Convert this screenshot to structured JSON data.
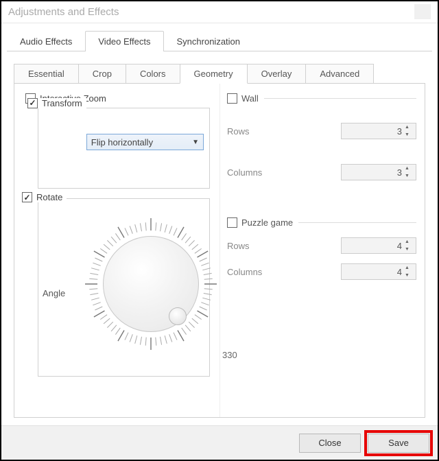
{
  "title": "Adjustments and Effects",
  "main_tabs": {
    "audio": "Audio Effects",
    "video": "Video Effects",
    "sync": "Synchronization"
  },
  "sub_tabs": {
    "essential": "Essential",
    "crop": "Crop",
    "colors": "Colors",
    "geometry": "Geometry",
    "overlay": "Overlay",
    "advanced": "Advanced"
  },
  "left": {
    "interactive_zoom": "Interactive Zoom",
    "transform": "Transform",
    "transform_value": "Flip horizontally",
    "rotate": "Rotate",
    "angle_label": "Angle",
    "tick_label": "330"
  },
  "right": {
    "wall": {
      "label": "Wall",
      "rows_label": "Rows",
      "rows": "3",
      "cols_label": "Columns",
      "cols": "3"
    },
    "puzzle": {
      "label": "Puzzle game",
      "rows_label": "Rows",
      "rows": "4",
      "cols_label": "Columns",
      "cols": "4"
    }
  },
  "footer": {
    "close": "Close",
    "save": "Save"
  }
}
